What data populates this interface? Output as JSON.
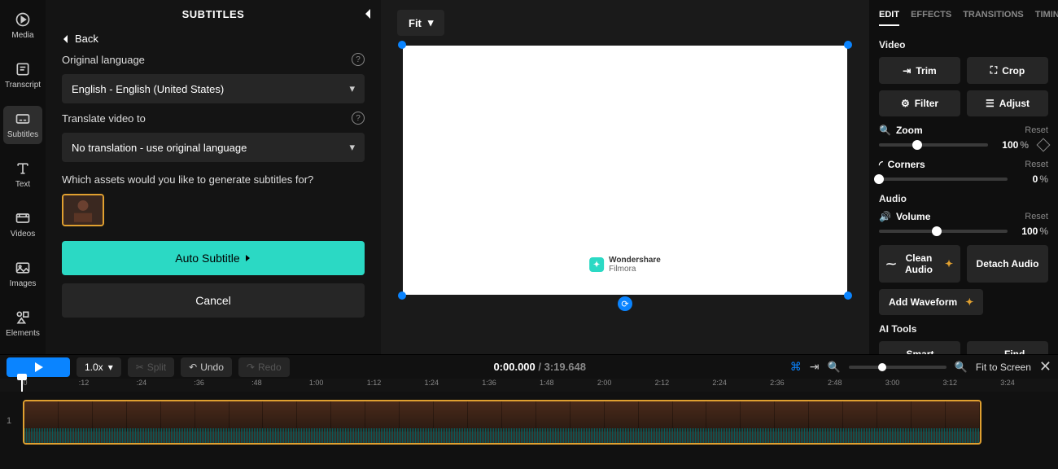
{
  "sidebar": {
    "items": [
      {
        "label": "Media"
      },
      {
        "label": "Transcript"
      },
      {
        "label": "Subtitles"
      },
      {
        "label": "Text"
      },
      {
        "label": "Videos"
      },
      {
        "label": "Images"
      },
      {
        "label": "Elements"
      }
    ]
  },
  "subtitle_panel": {
    "title": "SUBTITLES",
    "back": "Back",
    "original_language_label": "Original language",
    "original_language_value": "English - English (United States)",
    "translate_label": "Translate video to",
    "translate_value": "No translation - use original language",
    "assets_prompt": "Which assets would you like to generate subtitles for?",
    "auto_subtitle": "Auto Subtitle",
    "cancel": "Cancel"
  },
  "preview": {
    "fit": "Fit",
    "watermark_brand": "Wondershare",
    "watermark_product": "Filmora"
  },
  "right_panel": {
    "tabs": {
      "edit": "EDIT",
      "effects": "EFFECTS",
      "transitions": "TRANSITIONS",
      "timing": "TIMING"
    },
    "video_section": "Video",
    "trim": "Trim",
    "crop": "Crop",
    "filter": "Filter",
    "adjust": "Adjust",
    "zoom_label": "Zoom",
    "zoom_value": "100",
    "zoom_unit": "%",
    "reset": "Reset",
    "corners_label": "Corners",
    "corners_value": "0",
    "corners_unit": "%",
    "audio_section": "Audio",
    "volume_label": "Volume",
    "volume_value": "100",
    "volume_unit": "%",
    "clean_audio": "Clean Audio",
    "detach_audio": "Detach Audio",
    "add_waveform": "Add Waveform",
    "ai_section": "AI Tools",
    "smart_cut": "Smart Cut",
    "find_scenes": "Find Scenes"
  },
  "timeline_controls": {
    "speed": "1.0x",
    "split": "Split",
    "undo": "Undo",
    "redo": "Redo",
    "current_time": "0:00.000",
    "duration": "3:19.648",
    "fit_screen": "Fit to Screen"
  },
  "ruler": {
    "ticks": [
      ":0",
      ":12",
      ":24",
      ":36",
      ":48",
      "1:00",
      "1:12",
      "1:24",
      "1:36",
      "1:48",
      "2:00",
      "2:12",
      "2:24",
      "2:36",
      "2:48",
      "3:00",
      "3:12",
      "3:24"
    ]
  },
  "track_row": "1"
}
